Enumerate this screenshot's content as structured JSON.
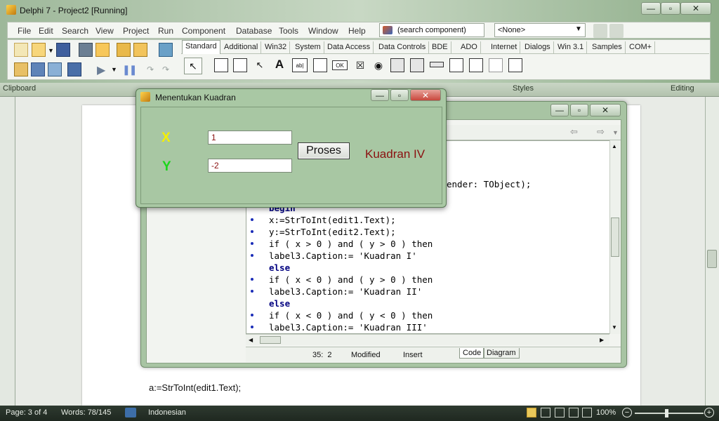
{
  "ide": {
    "title": "Delphi 7 - Project2 [Running]",
    "menu": [
      "File",
      "Edit",
      "Search",
      "View",
      "Project",
      "Run",
      "Component",
      "Database",
      "Tools",
      "Window",
      "Help"
    ],
    "search_component": "(search component)",
    "none_select": "<None>",
    "palette_tabs": [
      "Standard",
      "Additional",
      "Win32",
      "System",
      "Data Access",
      "Data Controls",
      "BDE",
      "ADO",
      "Internet",
      "Dialogs",
      "Win 3.1",
      "Samples",
      "COM+"
    ]
  },
  "word": {
    "ribbon_groups": [
      "Clipboard",
      "Styles",
      "Editing"
    ],
    "doc_text": "a:=StrToInt(edit1.Text);",
    "status": {
      "page": "Page: 3 of 4",
      "words": "Words: 78/145",
      "language": "Indonesian",
      "zoom": "100%"
    }
  },
  "form": {
    "title": "Menentukan Kuadran",
    "x_label": "X",
    "y_label": "Y",
    "edit1": "1",
    "edit2": "-2",
    "button": "Proses",
    "result": "Kuadran IV"
  },
  "editor": {
    "header_fragment": "ender: TObject);",
    "lines": [
      "begin",
      "x:=StrToInt(edit1.Text);",
      "y:=StrToInt(edit2.Text);",
      "if ( x > 0 ) and ( y > 0 ) then",
      "label3.Caption:= 'Kuadran I'",
      "else",
      "if ( x < 0 ) and ( y > 0 ) then",
      "label3.Caption:= 'Kuadran II'",
      "else",
      "if ( x < 0 ) and ( y < 0 ) then",
      "label3.Caption:= 'Kuadran III'"
    ],
    "status_pos": "35:  2",
    "status_modified": "Modified",
    "status_insert": "Insert",
    "tab_code": "Code",
    "tab_diagram": "Diagram"
  }
}
